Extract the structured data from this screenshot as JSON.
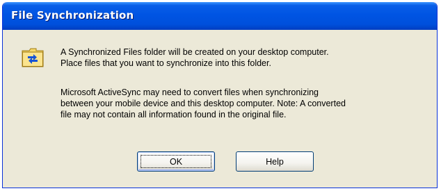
{
  "dialog": {
    "title": "File Synchronization",
    "icon": "sync-folder-icon",
    "message_1": "A Synchronized Files folder will be created on your desktop computer.\nPlace files that you want to synchronize into this folder.",
    "message_2": "Microsoft ActiveSync may need to convert files when synchronizing\nbetween your mobile device and this desktop computer.  Note: A converted\nfile may not contain all information found in the original file.",
    "buttons": {
      "ok_label": "OK",
      "help_label": "Help"
    }
  },
  "colors": {
    "titlebar": "#0054e3",
    "client": "#ece9d8",
    "folder": "#f5d86b",
    "arrows": "#1553d6"
  }
}
